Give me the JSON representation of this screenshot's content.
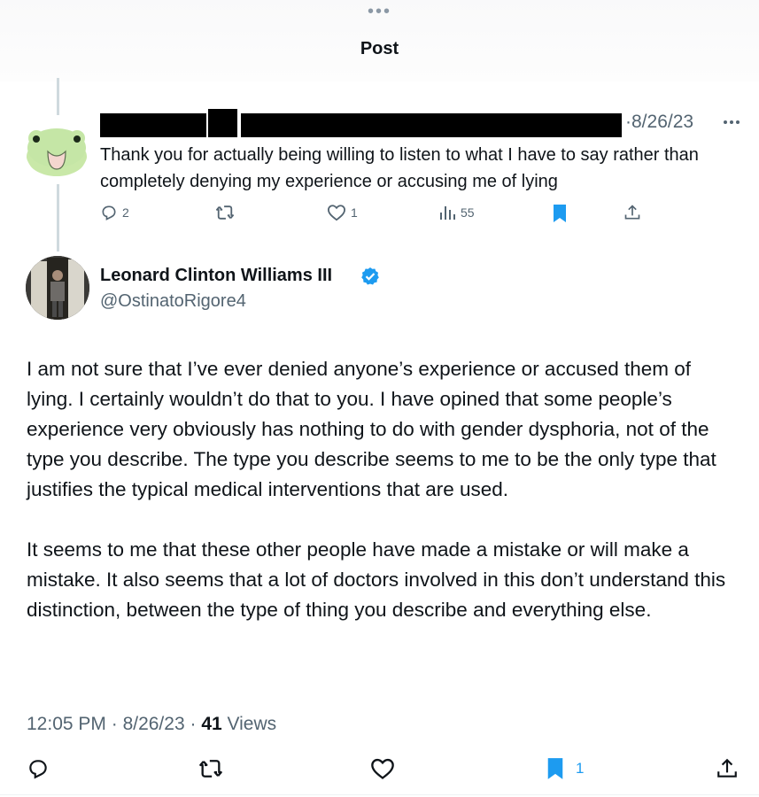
{
  "header": {
    "title": "Post"
  },
  "reply": {
    "date": "8/26/23",
    "separator": "·",
    "text": "Thank you for actually being willing to listen to what I have to say rather than completely denying my experience or accusing me of lying",
    "actions": {
      "replies": "2",
      "likes": "1",
      "views": "55"
    },
    "colors": {
      "bookmark": "#1d9bf0",
      "avatar_bg": "#c5e6a6"
    },
    "icons": [
      "reply-icon",
      "retweet-icon",
      "like-icon",
      "views-icon",
      "bookmark-icon",
      "share-icon",
      "more-icon"
    ]
  },
  "main_post": {
    "display_name": "Leonard Clinton Williams III",
    "handle": "@OstinatoRigore4",
    "verified": true,
    "paragraphs": [
      "I am not sure that I’ve ever denied anyone’s experience or accused them of lying. I certainly wouldn’t do that to you. I have opined that some people’s experience very obviously has nothing to do with gender dysphoria, not of the type you describe. The type you describe seems to me to be the only type that justifies the typical medical interventions that are used.",
      "It seems to me that these other people have made a mistake or will make a mistake. It also seems that a lot of doctors involved in this don’t understand this distinction, between the type of thing you describe and everything else."
    ],
    "meta": {
      "time": "12:05 PM",
      "sep1": " · ",
      "date": "8/26/23",
      "sep2": " · ",
      "views_count": "41",
      "views_label": " Views"
    },
    "actions": {
      "bookmarks": "1"
    },
    "colors": {
      "verified": "#1d9bf0",
      "bookmark": "#1d9bf0"
    }
  }
}
